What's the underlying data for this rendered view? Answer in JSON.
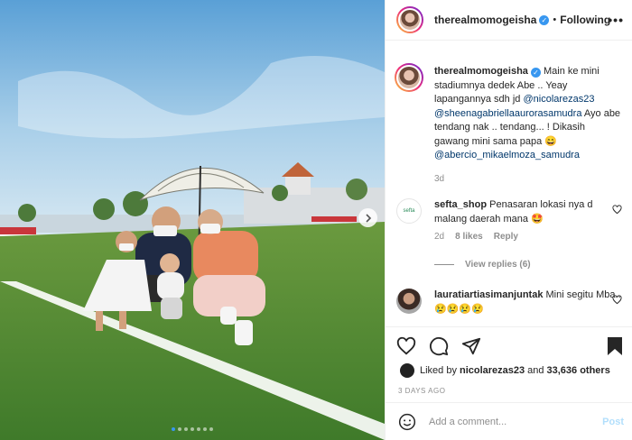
{
  "post": {
    "username": "therealmomogeisha",
    "following_label": "Following",
    "more_label": "•••"
  },
  "caption": {
    "username": "therealmomogeisha",
    "text_1": " Main ke mini stadiumnya dedek Abe .. Yeay lapangannya sdh jd ",
    "mention_1": "@nicolarezas23",
    "mention_2": "@sheenagabriellaaurorasamudra",
    "text_2": " Ayo abe tendang nak .. tendang... ! Dikasih gawang mini sama papa 😄 ",
    "mention_3": "@abercio_mikaelmoza_samudra",
    "time": "3d"
  },
  "comments": [
    {
      "username": "sefta_shop",
      "text": " Penasaran lokasi nya d malang daerah mana 🤩",
      "time": "2d",
      "likes": "8 likes",
      "reply": "Reply",
      "view_replies": "View replies (6)",
      "avatar_text": "sefta"
    },
    {
      "username": "lauratiartiasimanjuntak",
      "text": " Mini segitu Mba..😢😢😢😢"
    }
  ],
  "footer": {
    "liked_by_prefix": "Liked by ",
    "liked_by_user": "nicolarezas23",
    "liked_by_mid": " and ",
    "liked_by_count": "33,636 others",
    "timestamp": "3 DAYS AGO",
    "comment_placeholder": "Add a comment...",
    "post_label": "Post"
  },
  "carousel": {
    "slides": 7,
    "active": 0
  },
  "colors": {
    "accent": "#3897f0",
    "mention": "#00376b",
    "muted": "#8e8e8e"
  }
}
